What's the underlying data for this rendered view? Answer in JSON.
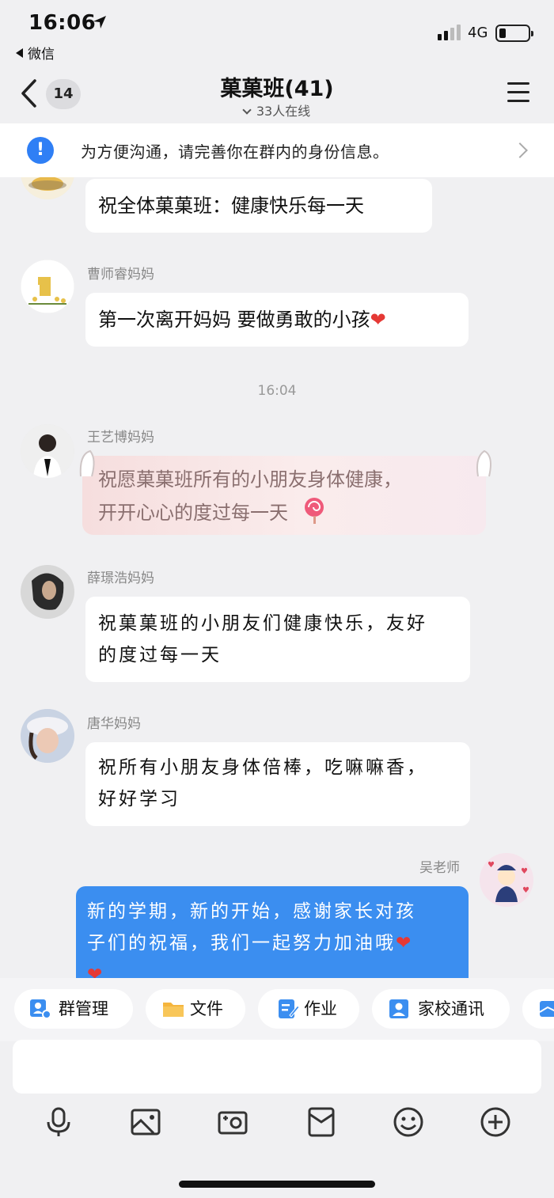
{
  "status_bar": {
    "time": "16:06",
    "back_app": "微信",
    "network": "4G"
  },
  "nav": {
    "unread_count": "14",
    "title": "菓菓班(41)",
    "online": "33人在线"
  },
  "notice": {
    "text": "为方便沟通，请完善你在群内的身份信息。"
  },
  "messages": [
    {
      "sender": "",
      "text": "祝全体菓菓班：健康快乐每一天"
    },
    {
      "sender": "曹师睿妈妈",
      "text": "第一次离开妈妈 要做勇敢的小孩"
    },
    {
      "sender": "王艺博妈妈",
      "text_line1": "祝愿菓菓班所有的小朋友身体健康，",
      "text_line2": "开开心心的度过每一天"
    },
    {
      "sender": "薛璟浩妈妈",
      "text_line1": "祝菓菓班的小朋友们健康快乐，友好",
      "text_line2": "的度过每一天"
    },
    {
      "sender": "唐华妈妈",
      "text_line1": "祝所有小朋友身体倍棒，吃嘛嘛香，",
      "text_line2": "好好学习"
    },
    {
      "sender": "吴老师",
      "text_line1": "新的学期，新的开始，感谢家长对孩",
      "text_line2": "子们的祝福，我们一起努力加油哦"
    }
  ],
  "time_divider": "16:04",
  "tools": {
    "group_manage": "群管理",
    "files": "文件",
    "homework": "作业",
    "contacts": "家校通讯"
  },
  "colors": {
    "accent": "#2f7ff5",
    "self_bubble": "#3b8ef0",
    "heart": "#e53935"
  }
}
